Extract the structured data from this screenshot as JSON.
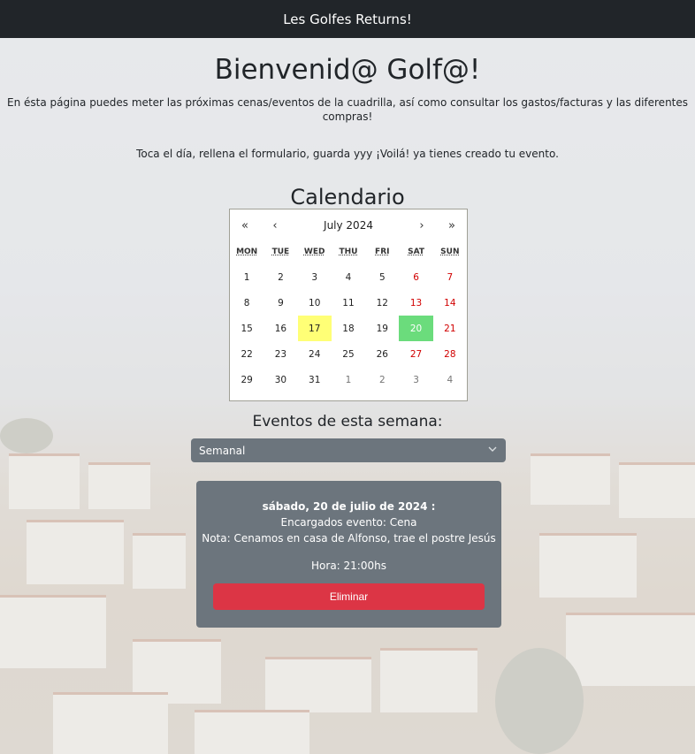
{
  "navbar": {
    "brand": "Les Golfes Returns!"
  },
  "header": {
    "title": "Bienvenid@ Golf@!",
    "intro": "En ésta página puedes meter las próximas cenas/eventos de la cuadrilla, así como consultar los gastos/facturas y las diferentes compras!",
    "instructions": "Toca el día, rellena el formulario, guarda yyy ¡Voilá! ya tienes creado tu evento."
  },
  "calendar": {
    "title": "Calendario",
    "nav": {
      "prev_year": "«",
      "prev_month": "‹",
      "label": "July 2024",
      "next_month": "›",
      "next_year": "»"
    },
    "weekdays": [
      "MON",
      "TUE",
      "WED",
      "THU",
      "FRI",
      "SAT",
      "SUN"
    ],
    "days": [
      {
        "d": "1"
      },
      {
        "d": "2"
      },
      {
        "d": "3"
      },
      {
        "d": "4"
      },
      {
        "d": "5"
      },
      {
        "d": "6",
        "weekend": true
      },
      {
        "d": "7",
        "weekend": true
      },
      {
        "d": "8"
      },
      {
        "d": "9"
      },
      {
        "d": "10"
      },
      {
        "d": "11"
      },
      {
        "d": "12"
      },
      {
        "d": "13",
        "weekend": true
      },
      {
        "d": "14",
        "weekend": true
      },
      {
        "d": "15"
      },
      {
        "d": "16"
      },
      {
        "d": "17",
        "today": true
      },
      {
        "d": "18"
      },
      {
        "d": "19"
      },
      {
        "d": "20",
        "event": true
      },
      {
        "d": "21",
        "weekend": true
      },
      {
        "d": "22"
      },
      {
        "d": "23"
      },
      {
        "d": "24"
      },
      {
        "d": "25"
      },
      {
        "d": "26"
      },
      {
        "d": "27",
        "weekend": true
      },
      {
        "d": "28",
        "weekend": true
      },
      {
        "d": "29"
      },
      {
        "d": "30"
      },
      {
        "d": "31"
      },
      {
        "d": "1",
        "neighbor": true
      },
      {
        "d": "2",
        "neighbor": true
      },
      {
        "d": "3",
        "neighbor": true
      },
      {
        "d": "4",
        "neighbor": true
      }
    ],
    "colors": {
      "today": "#ffff76",
      "event": "#6bdc7c",
      "weekend": "#d10000"
    }
  },
  "events": {
    "title": "Eventos de esta semana:",
    "filter": {
      "selected": "Semanal",
      "icon": "chevron-down-icon"
    },
    "items": [
      {
        "date": "sábado, 20 de julio de 2024 :",
        "encargados": "Encargados evento: Cena",
        "nota": "Nota: Cenamos en casa de Alfonso, trae el postre Jesús",
        "hora": "Hora: 21:00hs",
        "delete_label": "Eliminar"
      }
    ]
  },
  "colors": {
    "navbar": "#212529",
    "card": "#6c757d",
    "danger": "#dc3545"
  }
}
